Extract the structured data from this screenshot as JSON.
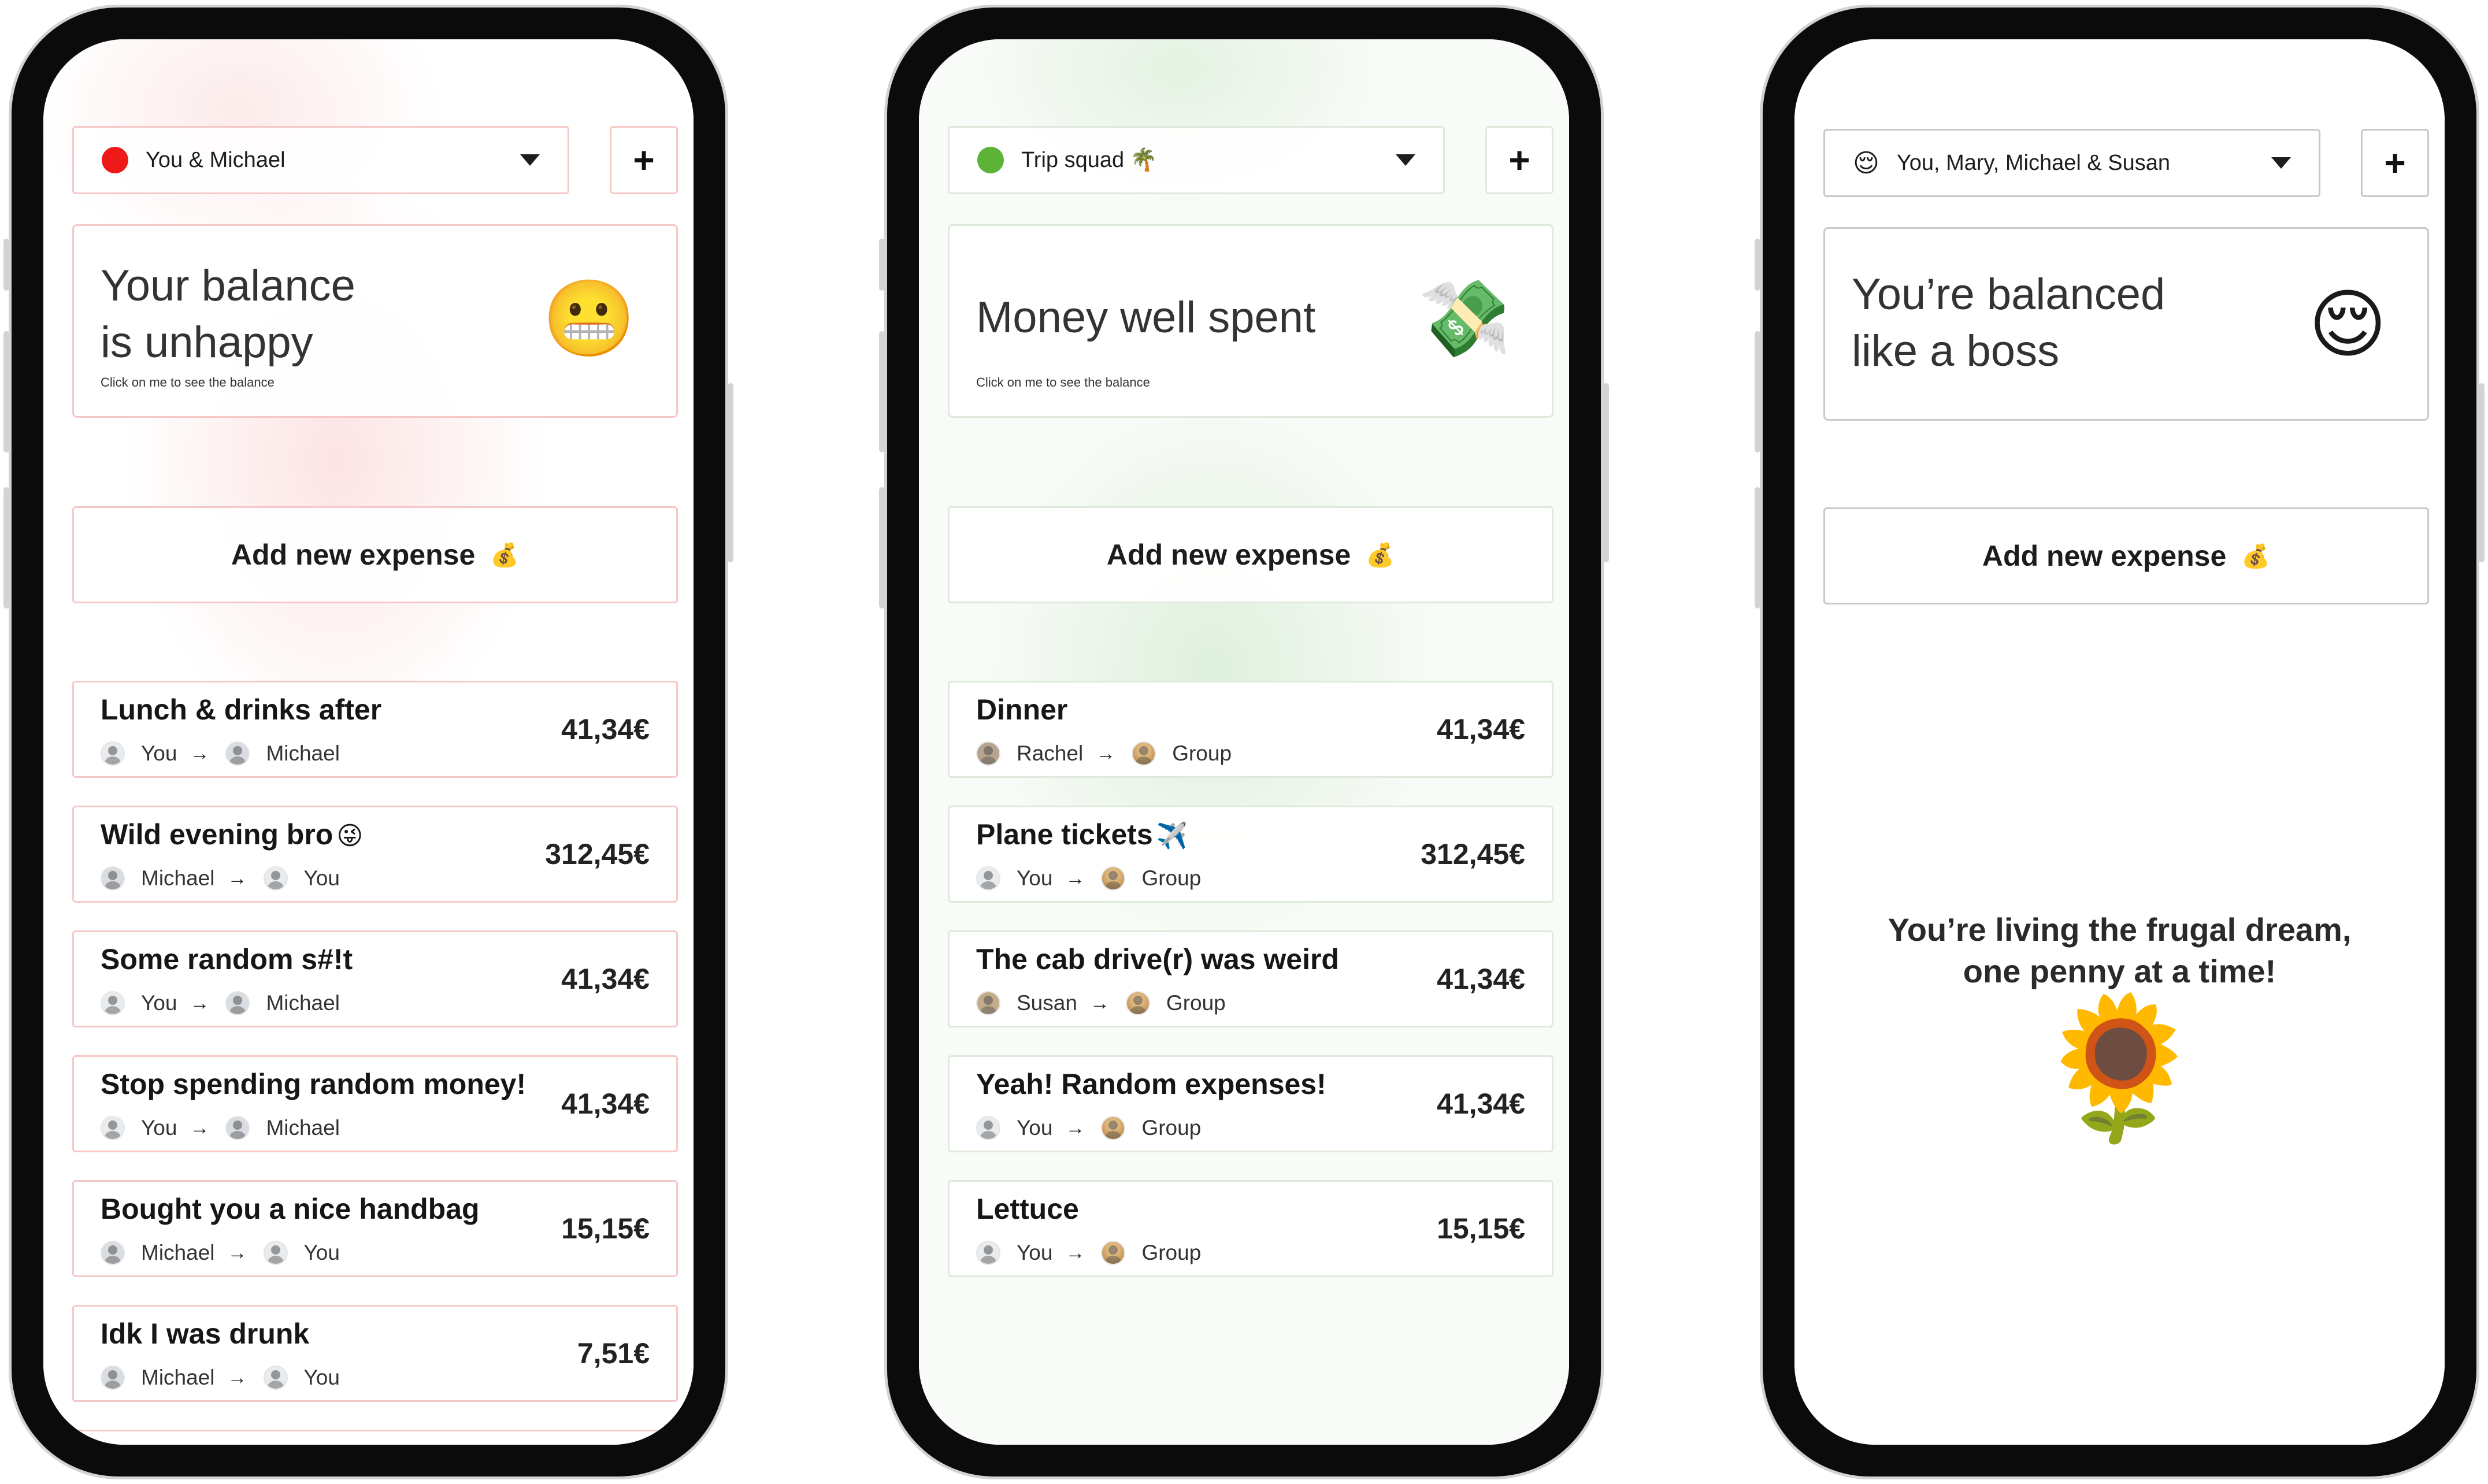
{
  "screens": [
    {
      "group": {
        "label": "You & Michael",
        "dot_color": "#ee1a1a"
      },
      "balance": {
        "title_line1": "Your balance",
        "title_line2": "is unhappy",
        "hint": "Click on me to see the balance",
        "emoji": "😬"
      },
      "add_button": {
        "label": "Add new expense",
        "emoji": "💰"
      },
      "plus": "+",
      "expenses": [
        {
          "title": "Lunch & drinks after",
          "emoji": "",
          "from": "You",
          "to": "Michael",
          "amount": "41,34€"
        },
        {
          "title": "Wild evening bro",
          "emoji": "😜",
          "from": "Michael",
          "to": "You",
          "amount": "312,45€"
        },
        {
          "title": "Some random s#!t",
          "emoji": "",
          "from": "You",
          "to": "Michael",
          "amount": "41,34€"
        },
        {
          "title": "Stop spending random money!",
          "emoji": "",
          "from": "You",
          "to": "Michael",
          "amount": "41,34€"
        },
        {
          "title": "Bought you a nice handbag",
          "emoji": "",
          "from": "Michael",
          "to": "You",
          "amount": "15,15€"
        },
        {
          "title": "Idk I was drunk",
          "emoji": "",
          "from": "Michael",
          "to": "You",
          "amount": "7,51€"
        }
      ]
    },
    {
      "group": {
        "label": "Trip squad",
        "emoji": "🌴",
        "dot_color": "#5cb338"
      },
      "balance": {
        "title_line1": "Money well spent",
        "hint": "Click on me to see the balance",
        "emoji": "💸"
      },
      "add_button": {
        "label": "Add new expense",
        "emoji": "💰"
      },
      "plus": "+",
      "expenses": [
        {
          "title": "Dinner",
          "emoji": "",
          "from": "Rachel",
          "to": "Group",
          "amount": "41,34€"
        },
        {
          "title": "Plane tickets",
          "emoji": "✈️",
          "from": "You",
          "to": "Group",
          "amount": "312,45€"
        },
        {
          "title": "The cab drive(r) was weird",
          "emoji": "",
          "from": "Susan",
          "to": "Group",
          "amount": "41,34€"
        },
        {
          "title": "Yeah! Random expenses!",
          "emoji": "",
          "from": "You",
          "to": "Group",
          "amount": "41,34€"
        },
        {
          "title": "Lettuce",
          "emoji": "",
          "from": "You",
          "to": "Group",
          "amount": "15,15€"
        }
      ]
    },
    {
      "group": {
        "label": "You, Mary, Michael & Susan",
        "emoji": "😌"
      },
      "balance": {
        "title_line1": "You’re balanced",
        "title_line2": "like a boss",
        "emoji": "😌"
      },
      "add_button": {
        "label": "Add new expense",
        "emoji": "💰"
      },
      "plus": "+",
      "empty_state": {
        "line1": "You’re living the frugal dream,",
        "line2": "one penny at a time!",
        "emoji": "🌻"
      }
    }
  ],
  "arrow": "→"
}
